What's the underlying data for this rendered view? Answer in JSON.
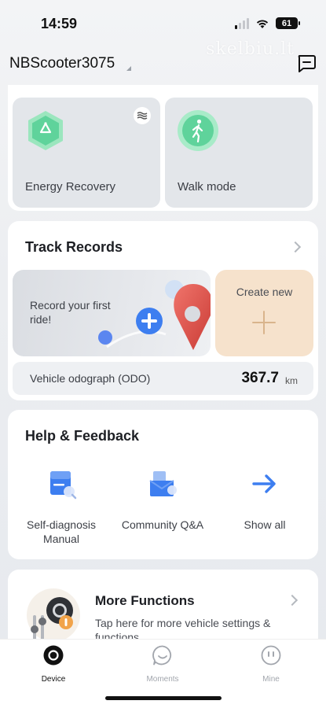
{
  "status_bar": {
    "time": "14:59",
    "battery": "61",
    "watermark": "skelbiu.lt"
  },
  "header": {
    "device_name": "NBScooter3075"
  },
  "modes": [
    {
      "label": "Energy Recovery",
      "icon": "recycle-hexagon-icon"
    },
    {
      "label": "Walk mode",
      "icon": "walking-person-icon"
    }
  ],
  "track_records": {
    "title": "Track Records",
    "record_prompt": "Record your first ride!",
    "create_label": "Create new",
    "odo_label": "Vehicle odograph (ODO)",
    "odo_value": "367.7",
    "odo_unit": "km"
  },
  "help_feedback": {
    "title": "Help & Feedback",
    "items": [
      {
        "label": "Self-diagnosis Manual",
        "icon": "manual-icon"
      },
      {
        "label": "Community Q&A",
        "icon": "community-qa-icon"
      },
      {
        "label": "Show all",
        "icon": "arrow-right-icon"
      }
    ]
  },
  "more_functions": {
    "title": "More Functions",
    "subtitle": "Tap here for more vehicle settings & functions"
  },
  "tabbar": {
    "items": [
      {
        "label": "Device",
        "icon": "device-icon",
        "active": true
      },
      {
        "label": "Moments",
        "icon": "moments-icon",
        "active": false
      },
      {
        "label": "Mine",
        "icon": "mine-icon",
        "active": false
      }
    ]
  },
  "colors": {
    "accent_green": "#5fd39b",
    "create_tile_bg": "#f6e2cc",
    "help_icon_blue": "#3d7ef0"
  }
}
